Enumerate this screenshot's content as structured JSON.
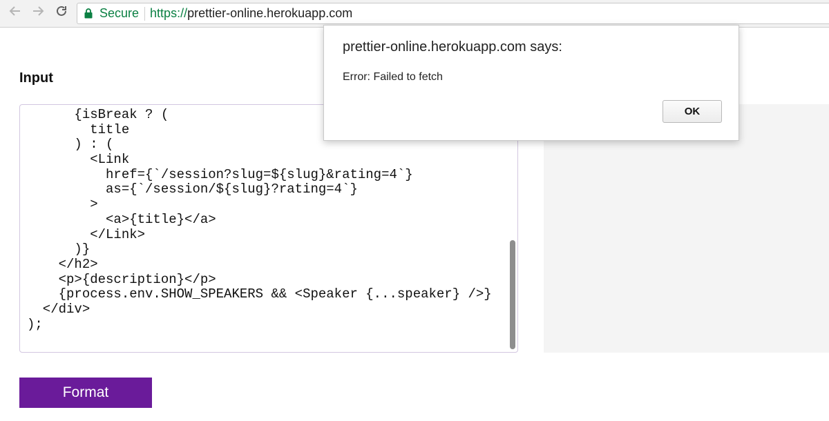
{
  "browser": {
    "back_icon": "arrow-left-icon",
    "forward_icon": "arrow-right-icon",
    "reload_icon": "reload-icon",
    "lock_icon": "lock-icon",
    "secure_label": "Secure",
    "url_scheme": "https://",
    "url_host": "prettier-online.herokuapp.com",
    "secure_color": "#0b8043"
  },
  "editor": {
    "label": "Input",
    "lines": [
      "      {isBreak ? (",
      "        title",
      "      ) : (",
      "        <Link",
      "          href={`/session?slug=${slug}&rating=4`}",
      "          as={`/session/${slug}?rating=4`}",
      "        >",
      "          <a>{title}</a>",
      "        </Link>",
      "      )}",
      "    </h2>",
      "    <p>{description}</p>",
      "    {process.env.SHOW_SPEAKERS && <Speaker {...speaker} />}",
      "  </div>",
      ");"
    ]
  },
  "actions": {
    "format_label": "Format",
    "accent_color": "#6a1b9a"
  },
  "dialog": {
    "title": "prettier-online.herokuapp.com says:",
    "message": "Error: Failed to fetch",
    "ok_label": "OK"
  }
}
